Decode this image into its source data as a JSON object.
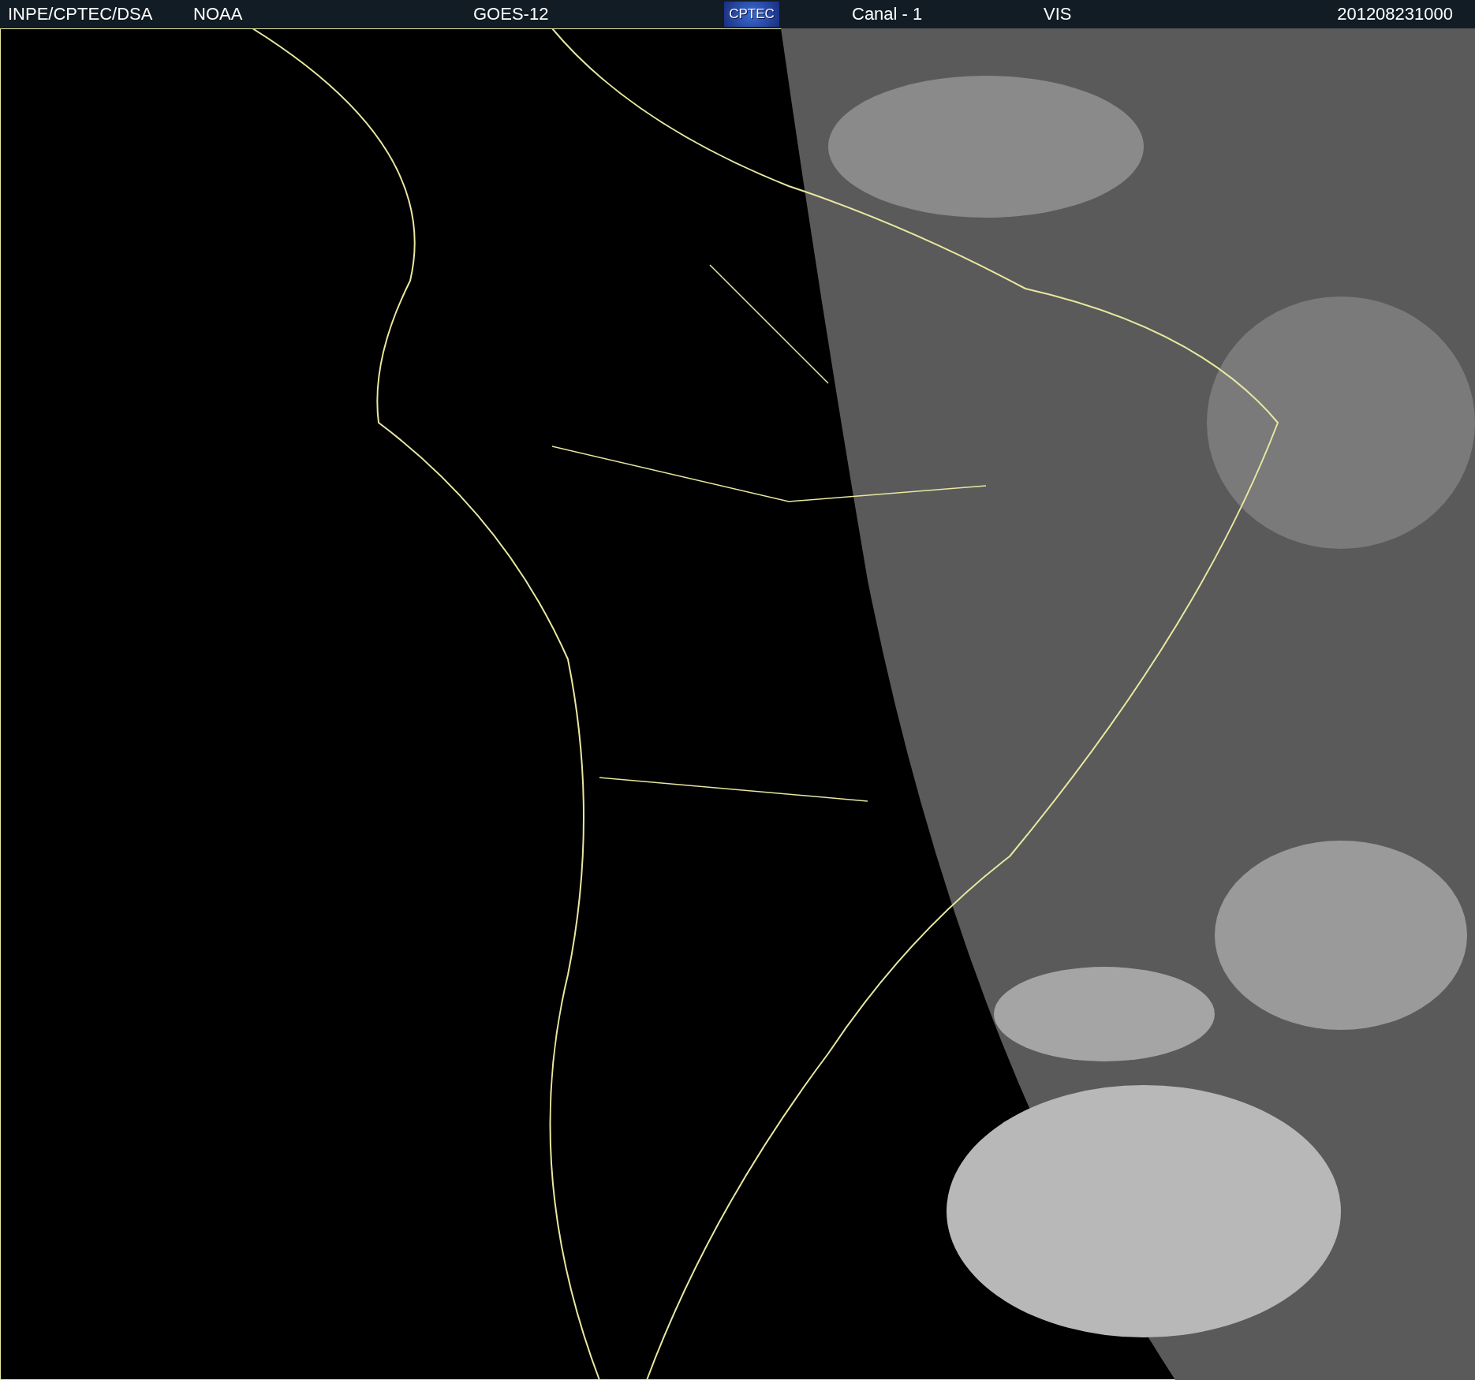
{
  "header": {
    "source": "INPE/CPTEC/DSA",
    "agency": "NOAA",
    "satellite": "GOES-12",
    "logo": "CPTEC",
    "channel": "Canal - 1",
    "band": "VIS",
    "timestamp": "201208231000"
  }
}
